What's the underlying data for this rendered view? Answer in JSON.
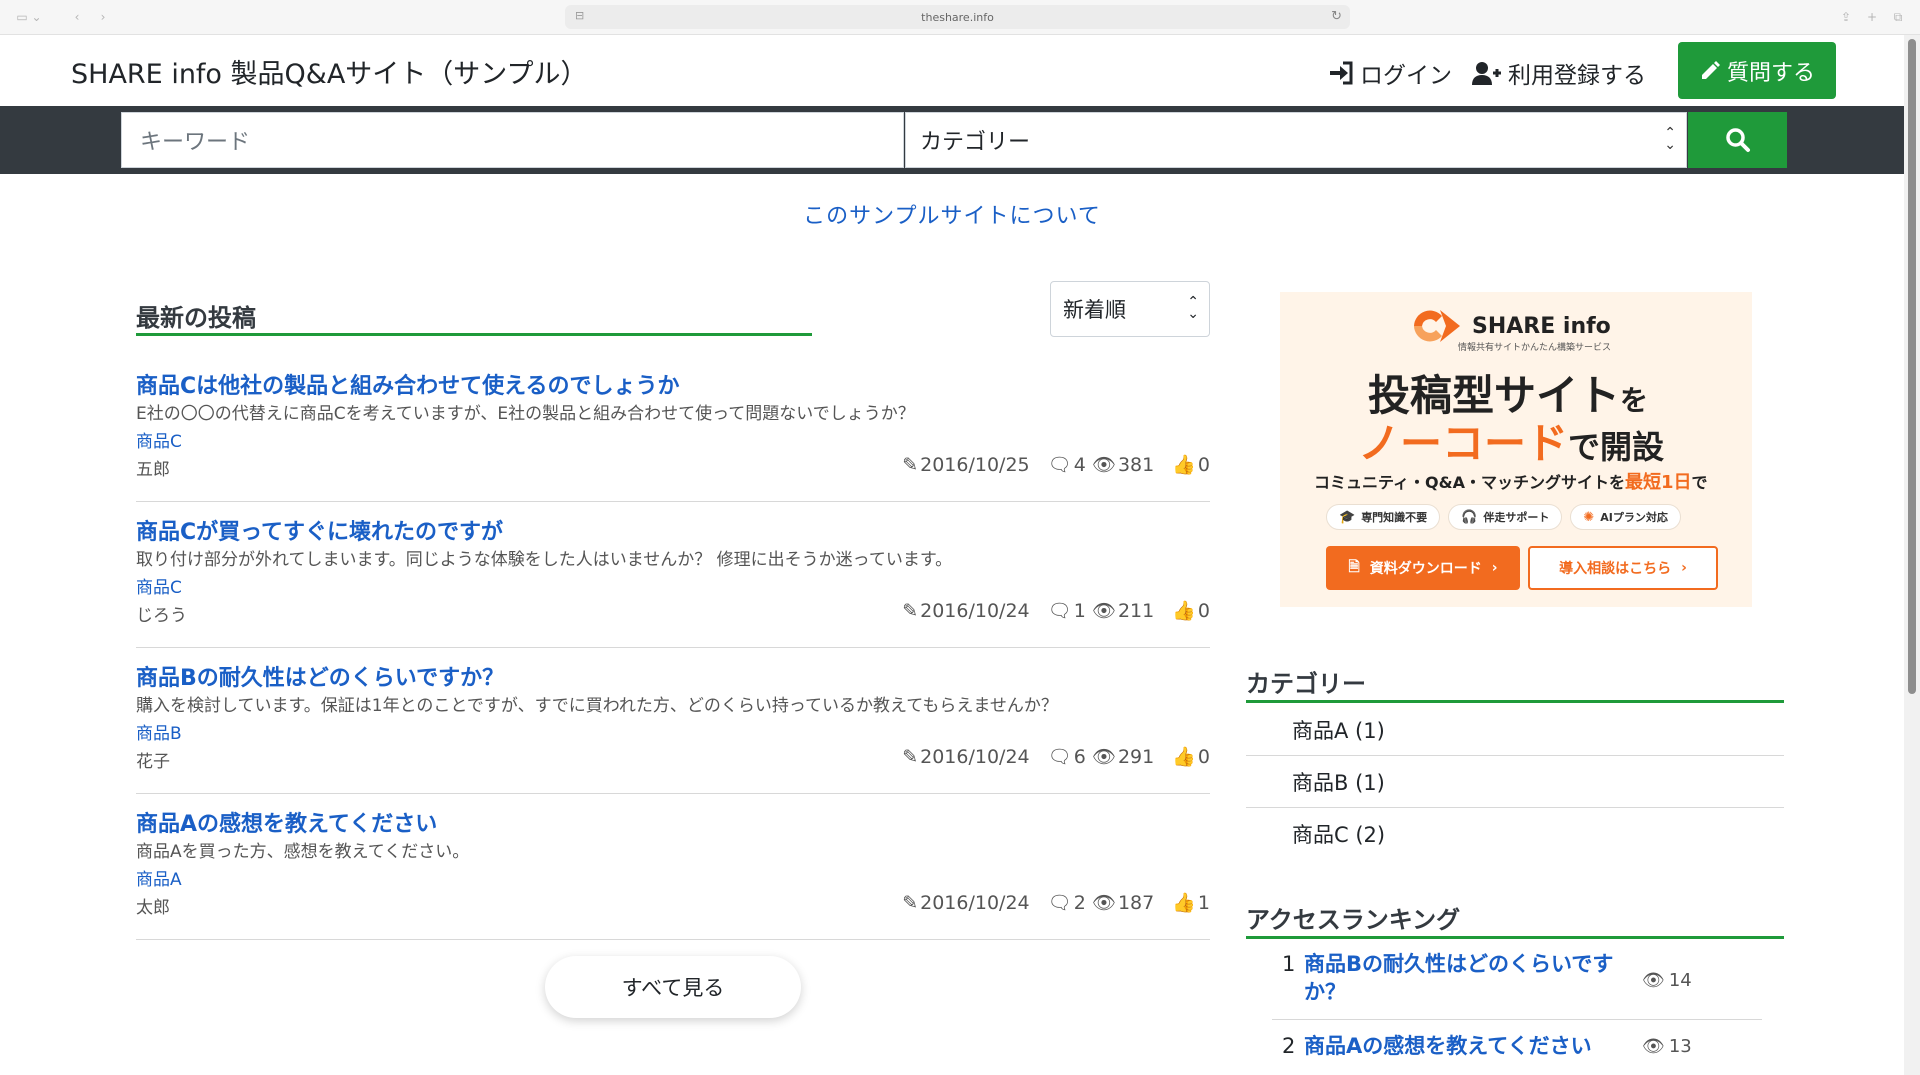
{
  "browser": {
    "url": "theshare.info"
  },
  "header": {
    "site_title": "SHARE info 製品Q&Aサイト（サンプル）",
    "login_label": "ログイン",
    "register_label": "利用登録する",
    "ask_label": "質問する"
  },
  "search": {
    "keyword_placeholder": "キーワード",
    "category_value": "カテゴリー"
  },
  "about_link": "このサンプルサイトについて",
  "latest": {
    "heading": "最新の投稿",
    "sort_value": "新着順",
    "posts": [
      {
        "title": "商品Cは他社の製品と組み合わせて使えるのでしょうか",
        "excerpt": "E社の〇〇の代替えに商品Cを考えていますが、E社の製品と組み合わせて使って問題ないでしょうか？",
        "category": "商品C",
        "author": "五郎",
        "date": "2016/10/25",
        "comments": "4",
        "views": "381",
        "likes": "0"
      },
      {
        "title": "商品Cが買ってすぐに壊れたのですが",
        "excerpt": "取り付け部分が外れてしまいます。同じような体験をした人はいませんか？ 修理に出そうか迷っています。",
        "category": "商品C",
        "author": "じろう",
        "date": "2016/10/24",
        "comments": "1",
        "views": "211",
        "likes": "0"
      },
      {
        "title": "商品Bの耐久性はどのくらいですか？",
        "excerpt": "購入を検討しています。保証は1年とのことですが、すでに買われた方、どのくらい持っているか教えてもらえませんか？",
        "category": "商品B",
        "author": "花子",
        "date": "2016/10/24",
        "comments": "6",
        "views": "291",
        "likes": "0"
      },
      {
        "title": "商品Aの感想を教えてください",
        "excerpt": "商品Aを買った方、感想を教えてください。",
        "category": "商品A",
        "author": "太郎",
        "date": "2016/10/24",
        "comments": "2",
        "views": "187",
        "likes": "1"
      }
    ],
    "see_all_label": "すべて見る"
  },
  "banner": {
    "brand": "SHARE info",
    "brand_sub": "情報共有サイトかんたん構築サービス",
    "headline1": "投稿型サイト",
    "headline1_suffix": "を",
    "headline2": "ノーコード",
    "headline2_suffix": "で開設",
    "line3_pre": "コミュニティ・Q&A・マッチングサイトを",
    "line3_accent": "最短1日",
    "line3_post": "で",
    "tags": [
      "専門知識不要",
      "伴走サポート",
      "AIプラン対応"
    ],
    "btn_download": "資料ダウンロード",
    "btn_consult": "導入相談はこちら",
    "accent_color": "#f26b1f"
  },
  "sidebar": {
    "category_heading": "カテゴリー",
    "categories": [
      "商品A (1)",
      "商品B (1)",
      "商品C (2)"
    ],
    "ranking_heading": "アクセスランキング",
    "ranking": [
      {
        "rank": "1",
        "title": "商品Bの耐久性はどのくらいですか？",
        "views": "14"
      },
      {
        "rank": "2",
        "title": "商品Aの感想を教えてください",
        "views": "13"
      }
    ]
  },
  "colors": {
    "brand_green": "#1f9a3a",
    "link_blue": "#1a5fc6",
    "dark_bar": "#343a40"
  }
}
